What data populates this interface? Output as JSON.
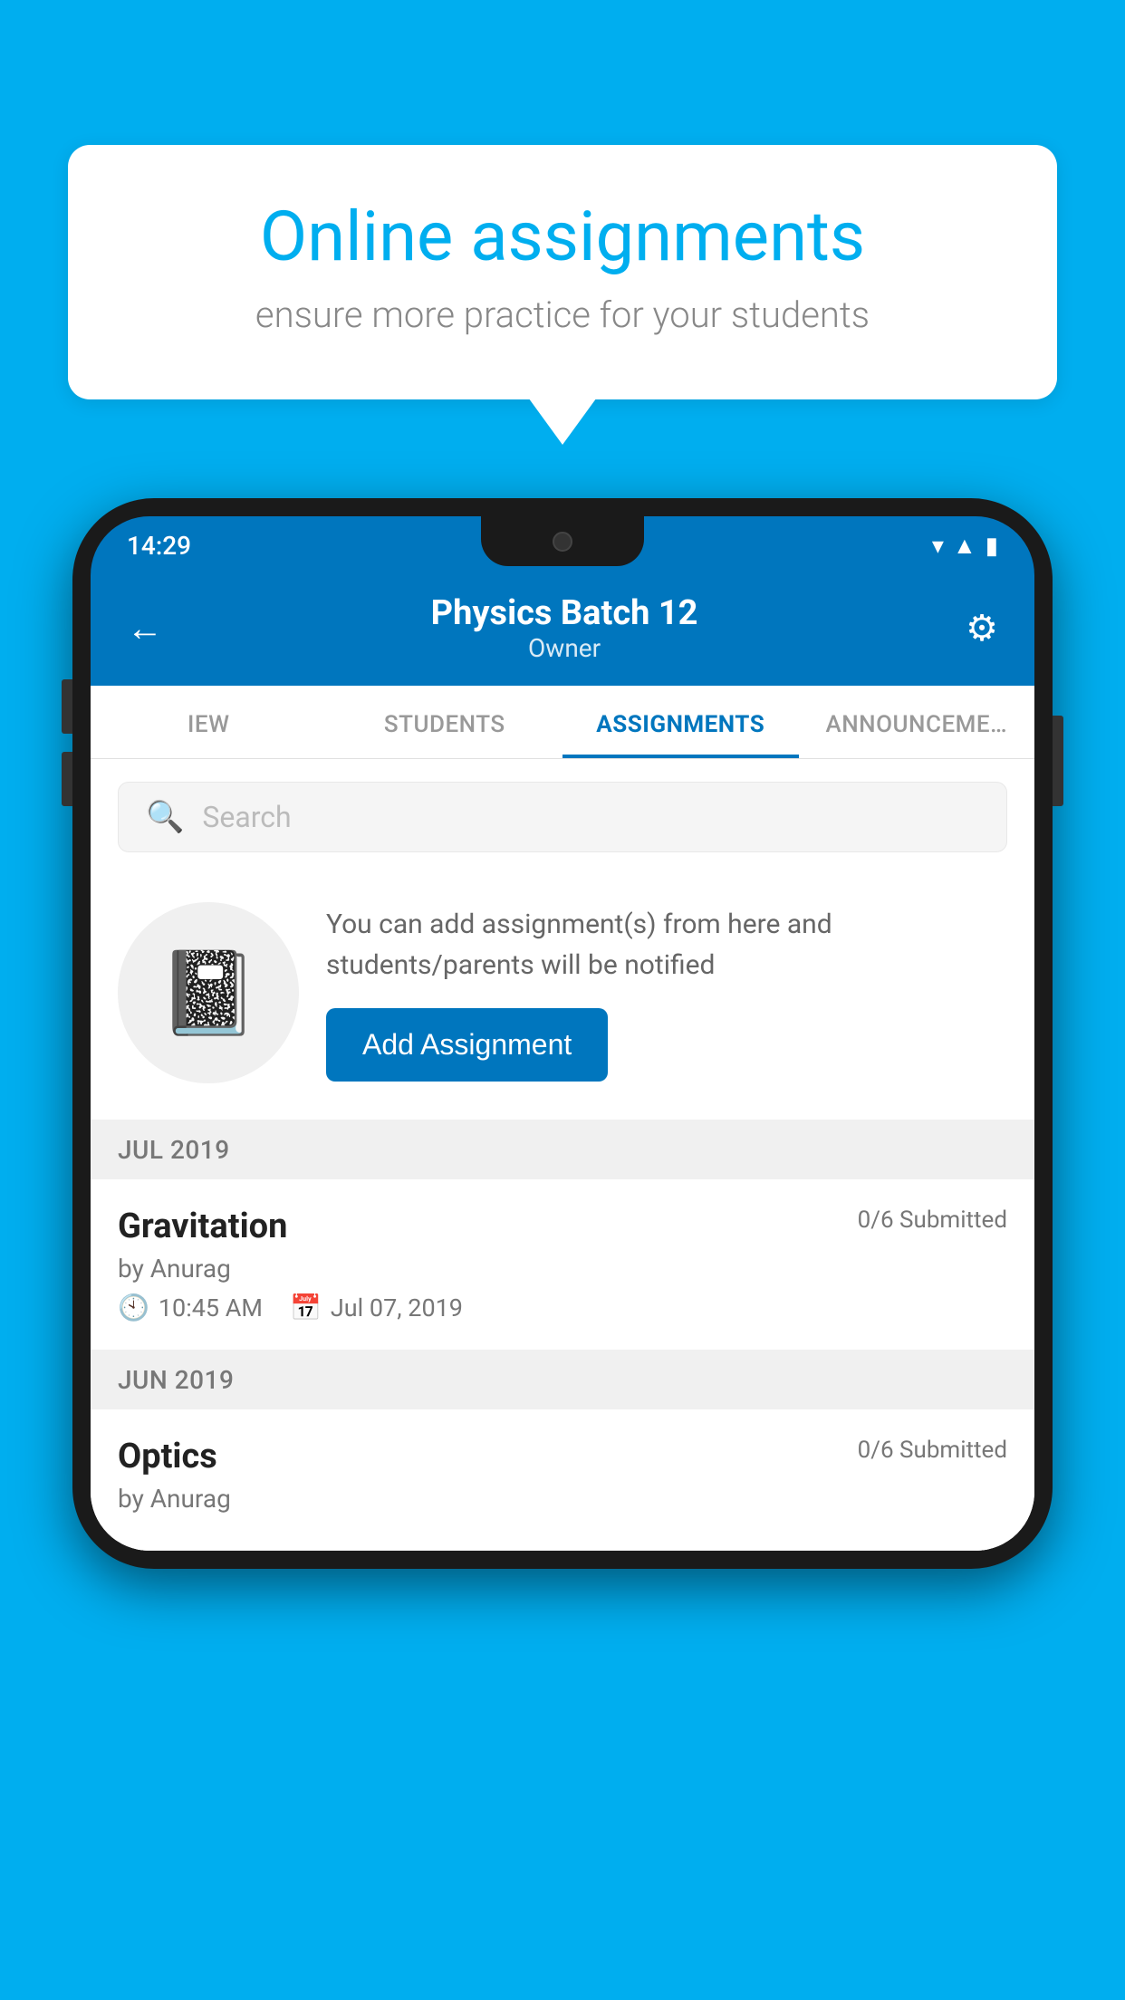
{
  "background_color": "#00AEEF",
  "speech_bubble": {
    "title": "Online assignments",
    "subtitle": "ensure more practice for your students"
  },
  "status_bar": {
    "time": "14:29",
    "icons": [
      "wifi",
      "signal",
      "battery"
    ]
  },
  "app_header": {
    "title": "Physics Batch 12",
    "subtitle": "Owner",
    "back_label": "←",
    "settings_label": "⚙"
  },
  "tabs": [
    {
      "label": "IEW",
      "active": false
    },
    {
      "label": "STUDENTS",
      "active": false
    },
    {
      "label": "ASSIGNMENTS",
      "active": true
    },
    {
      "label": "ANNOUNCEMENTS",
      "active": false
    }
  ],
  "search": {
    "placeholder": "Search"
  },
  "promo": {
    "description": "You can add assignment(s) from here and students/parents will be notified",
    "button_label": "Add Assignment"
  },
  "sections": [
    {
      "header": "JUL 2019",
      "assignments": [
        {
          "title": "Gravitation",
          "submitted": "0/6 Submitted",
          "author": "by Anurag",
          "time": "10:45 AM",
          "date": "Jul 07, 2019"
        }
      ]
    },
    {
      "header": "JUN 2019",
      "assignments": [
        {
          "title": "Optics",
          "submitted": "0/6 Submitted",
          "author": "by Anurag",
          "time": "",
          "date": ""
        }
      ]
    }
  ]
}
